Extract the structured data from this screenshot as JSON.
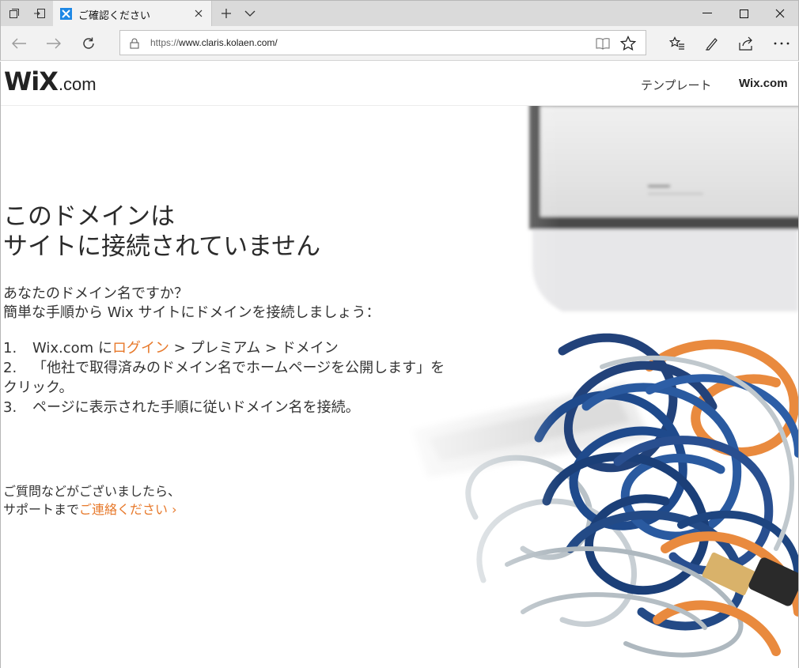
{
  "browser": {
    "tab_title": "ご確認ください",
    "url_prefix": "https://",
    "url_host": "www.claris.kolaen.com/",
    "colors": {
      "favicon": "#1e88e5",
      "tabbar": "#dadada"
    }
  },
  "site": {
    "logo_main": "WiX",
    "logo_suffix": ".com",
    "nav": {
      "templates": "テンプレート",
      "wix": "Wix.com"
    },
    "headline_line1": "このドメインは",
    "headline_line2": "サイトに接続されていません",
    "question": "あなたのドメイン名ですか？",
    "instruction": "簡単な手順から Wix サイトにドメインを接続しましょう：",
    "steps": {
      "s1_num": "1.",
      "s1_pre": "Wix.com に",
      "s1_link": "ログイン",
      "s1_post": " > プレミアム > ドメイン",
      "s2_num": "2.",
      "s2_text": "「他社で取得済みのドメイン名でホームページを公開します」を",
      "s2_cont": "クリック。",
      "s3_num": "3.",
      "s3_text": "ページに表示された手順に従いドメイン名を接続。"
    },
    "contact_line1": "ご質問などがございましたら、",
    "contact_pre": "サポートまで",
    "contact_link": "ご連絡ください ›",
    "accent_color": "#e7792b"
  }
}
